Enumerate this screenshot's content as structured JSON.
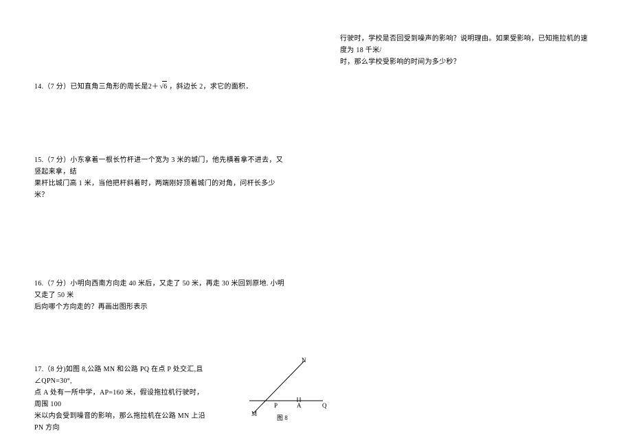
{
  "questions": {
    "q14": {
      "text": "14.（7 分）已知直角三角形的周长是 2＋√6 ，斜边长 2，求它的面积．",
      "prefix": "14.（7 分）已知直角三角形的周长是",
      "expr_base": "2＋",
      "expr_radicand": "6",
      "suffix": " ，斜边长 2，求它的面积．"
    },
    "q15": {
      "line1": "15.（7 分）小东拿着一根长竹杆进一个宽为 3 米的城门，他先横着拿不进去，又竖起来拿，结",
      "line2": "果杆比城门高 1 米，当他把杆斜着时，两端刚好顶着城门的对角，问杆长多少米？"
    },
    "q16": {
      "line1": "16.（7 分）小明向西南方向走 40 米后，又走了 50 米，再走 30 米回到原地. 小明又走了 50 米",
      "line2": "后向哪个方向走的？再画出图形表示"
    },
    "q17": {
      "line1": "17.（8 分)如图 8,公路 MN 和公路 PQ 在点 P 处交汇,且∠QPN=30°,",
      "line2": "点 A 处有一所中学，AP=160 米，假设拖拉机行驶时，周围 100",
      "line3": "米以内会受到噪音的影响，那么拖拉机在公路 MN 上沿 PN 方向",
      "cont_line1": "行驶时，学校是否回受到噪声的影响？说明理由。如果受影响，已知拖拉机的速度为 18 千米/",
      "cont_line2": "时，那么学校受影响的时间为多少秒？"
    }
  },
  "diagram": {
    "labels": {
      "N": "N",
      "Q": "Q",
      "A": "A",
      "P": "P",
      "M": "M"
    },
    "caption": "图 8"
  }
}
